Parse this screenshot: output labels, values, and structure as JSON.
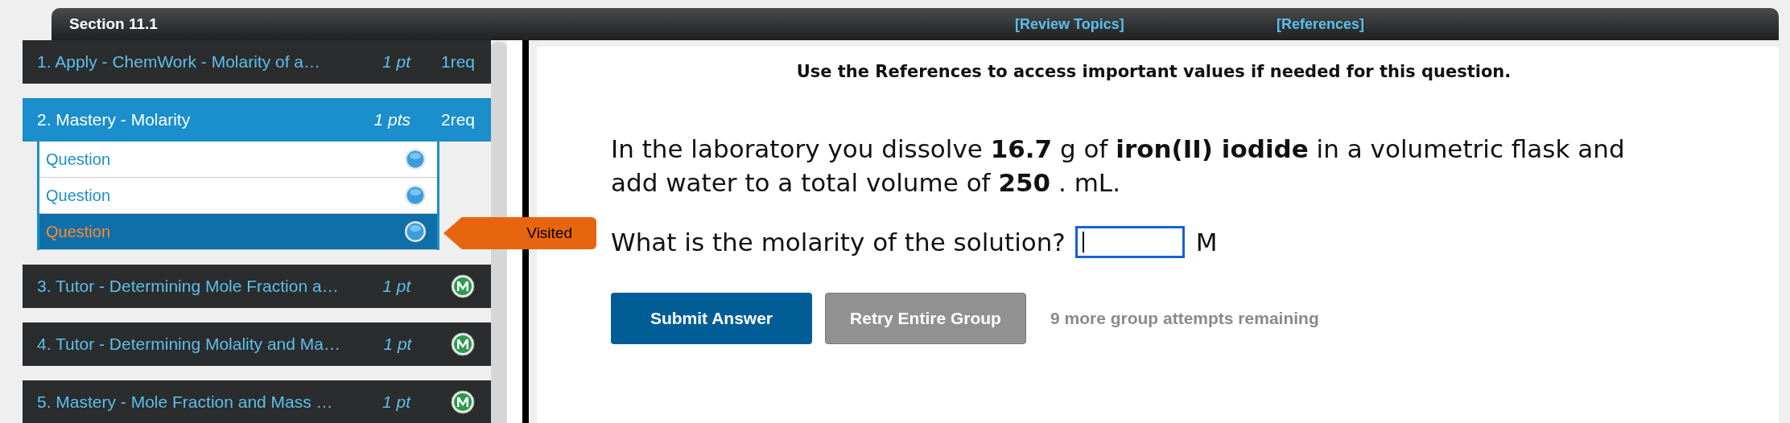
{
  "header": {
    "section_title": "Section 11.1",
    "links": [
      "[Review Topics]",
      "[References]"
    ]
  },
  "sidebar": {
    "items": [
      {
        "label": "1. Apply - ChemWork - Molarity of a…",
        "points": "1 pt",
        "kind": "required",
        "status": "1req",
        "selected": false
      },
      {
        "label": "2. Mastery - Molarity",
        "points": "1 pts",
        "kind": "required",
        "status": "2req",
        "selected": true,
        "expanded": true,
        "children": [
          {
            "label": "Question",
            "selected": false
          },
          {
            "label": "Question",
            "selected": false
          },
          {
            "label": "Question",
            "selected": true,
            "tooltip": "Visited"
          }
        ]
      },
      {
        "label": "3. Tutor - Determining Mole Fraction a…",
        "points": "1 pt",
        "kind": "mastered",
        "selected": false
      },
      {
        "label": "4. Tutor - Determining Molality and Ma…",
        "points": "1 pt",
        "kind": "mastered",
        "selected": false
      },
      {
        "label": "5. Mastery - Mole Fraction and Mass …",
        "points": "1 pt",
        "kind": "mastered",
        "selected": false
      }
    ]
  },
  "content": {
    "instruction": "Use the References to access important values if needed for this question.",
    "question": "In the laboratory you dissolve **16.7** g of **iron(II) iodide** in a volumetric flask and add water to a total volume of **250** . mL.",
    "prompt": "What is the molarity of the solution?",
    "answer": {
      "focused": true
    },
    "unit": "M",
    "buttons": [
      {
        "label": "Submit Answer",
        "kind": "primary"
      },
      {
        "label": "Retry Entire Group",
        "kind": "secondary"
      }
    ],
    "attempts": "9 more group attempts remaining"
  }
}
